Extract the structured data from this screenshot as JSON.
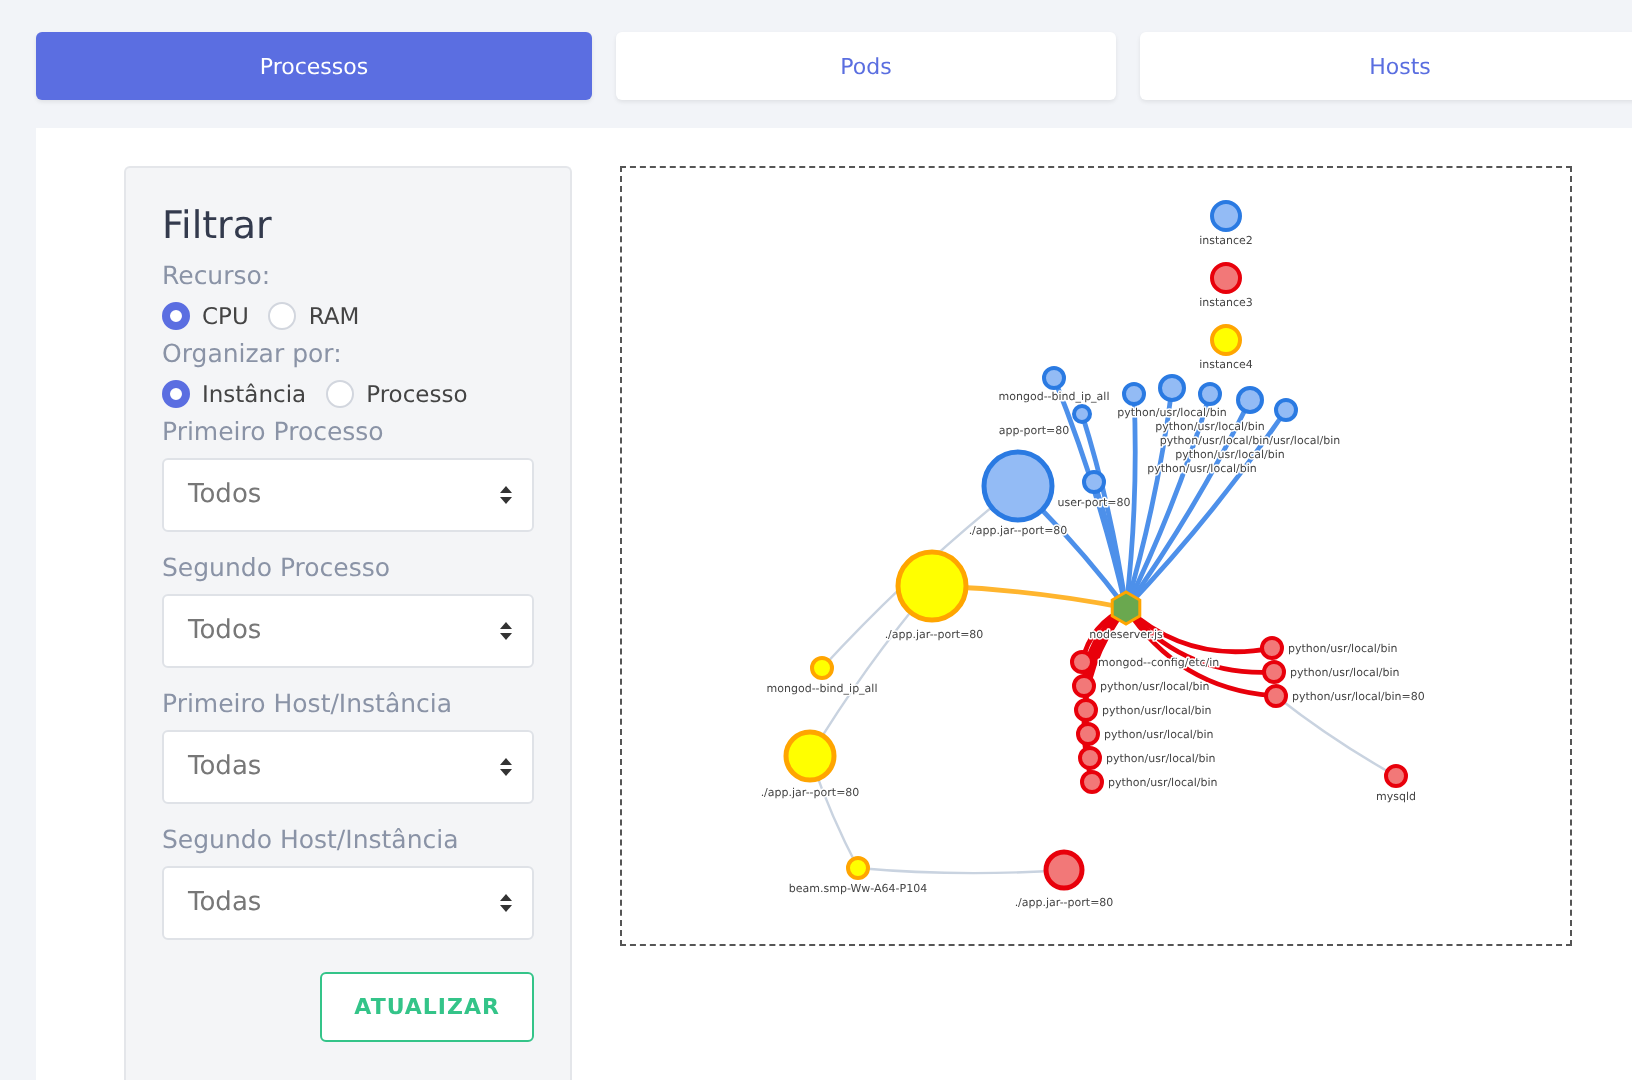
{
  "tabs": [
    {
      "label": "Processos",
      "selected": true
    },
    {
      "label": "Pods",
      "selected": false
    },
    {
      "label": "Hosts",
      "selected": false
    }
  ],
  "filter": {
    "title": "Filtrar",
    "groups": [
      {
        "label": "Recurso:",
        "options": [
          {
            "label": "CPU",
            "selected": true
          },
          {
            "label": "RAM",
            "selected": false
          }
        ]
      },
      {
        "label": "Organizar por:",
        "options": [
          {
            "label": "Instância",
            "selected": true
          },
          {
            "label": "Processo",
            "selected": false
          }
        ]
      }
    ],
    "selects": [
      {
        "label": "Primeiro Processo",
        "value": "Todos"
      },
      {
        "label": "Segundo Processo",
        "value": "Todos"
      },
      {
        "label": "Primeiro Host/Instância",
        "value": "Todas"
      },
      {
        "label": "Segundo Host/Instância",
        "value": "Todas"
      }
    ],
    "button": "ATUALIZAR"
  },
  "graph": {
    "nodes": [
      {
        "label": "instance2",
        "color": "#2a7ae2",
        "kind": "process"
      },
      {
        "label": "instance3",
        "color": "#e8000b",
        "kind": "process"
      },
      {
        "label": "instance4",
        "color": "#ffa500",
        "kind": "process"
      },
      {
        "label": "nodeserver.js",
        "color": "#6aa84f",
        "kind": "hub",
        "children": [
          {
            "label": "mongod--bind_ip_all",
            "color": "#2a7ae2",
            "kind": "process"
          },
          {
            "label": "app-port=80",
            "color": "#2a7ae2",
            "kind": "process"
          },
          {
            "label": "./app.jar--port=80",
            "color": "#2a7ae2",
            "kind": "process",
            "children": [
              {
                "label": "mongod--bind_ip_all",
                "color": "#ffa500",
                "kind": "process"
              }
            ]
          },
          {
            "label": "user-port=80",
            "color": "#2a7ae2",
            "kind": "process"
          },
          {
            "label": "python/usr/local/bin",
            "color": "#2a7ae2",
            "kind": "process"
          },
          {
            "label": "python/usr/local/bin",
            "color": "#2a7ae2",
            "kind": "process"
          },
          {
            "label": "python/usr/local/bin/usr/local/bin",
            "color": "#2a7ae2",
            "kind": "process"
          },
          {
            "label": "python/usr/local/bin",
            "color": "#2a7ae2",
            "kind": "process"
          },
          {
            "label": "python/usr/local/bin",
            "color": "#2a7ae2",
            "kind": "process"
          },
          {
            "label": "./app.jar--port=80",
            "color": "#ffa500",
            "kind": "process",
            "children": [
              {
                "label": "./app.jar--port=80",
                "color": "#ffa500",
                "kind": "process",
                "children": [
                  {
                    "label": "beam.smp-Ww-A64-P104",
                    "color": "#ffa500",
                    "kind": "process",
                    "children": [
                      {
                        "label": "./app.jar--port=80",
                        "color": "#e8000b",
                        "kind": "process"
                      }
                    ]
                  }
                ]
              }
            ]
          },
          {
            "label": "mongod--config/etc/in",
            "color": "#e8000b",
            "kind": "process"
          },
          {
            "label": "python/usr/local/bin",
            "color": "#e8000b",
            "kind": "process"
          },
          {
            "label": "python/usr/local/bin",
            "color": "#e8000b",
            "kind": "process"
          },
          {
            "label": "python/usr/local/bin",
            "color": "#e8000b",
            "kind": "process"
          },
          {
            "label": "python/usr/local/bin",
            "color": "#e8000b",
            "kind": "process"
          },
          {
            "label": "python/usr/local/bin",
            "color": "#e8000b",
            "kind": "process"
          },
          {
            "label": "python/usr/local/bin",
            "color": "#e8000b",
            "kind": "process"
          },
          {
            "label": "python/usr/local/bin",
            "color": "#e8000b",
            "kind": "process"
          },
          {
            "label": "python/usr/local/bin=80",
            "color": "#e8000b",
            "kind": "process",
            "children": [
              {
                "label": "mysqld",
                "color": "#e8000b",
                "kind": "process"
              }
            ]
          }
        ]
      }
    ]
  }
}
